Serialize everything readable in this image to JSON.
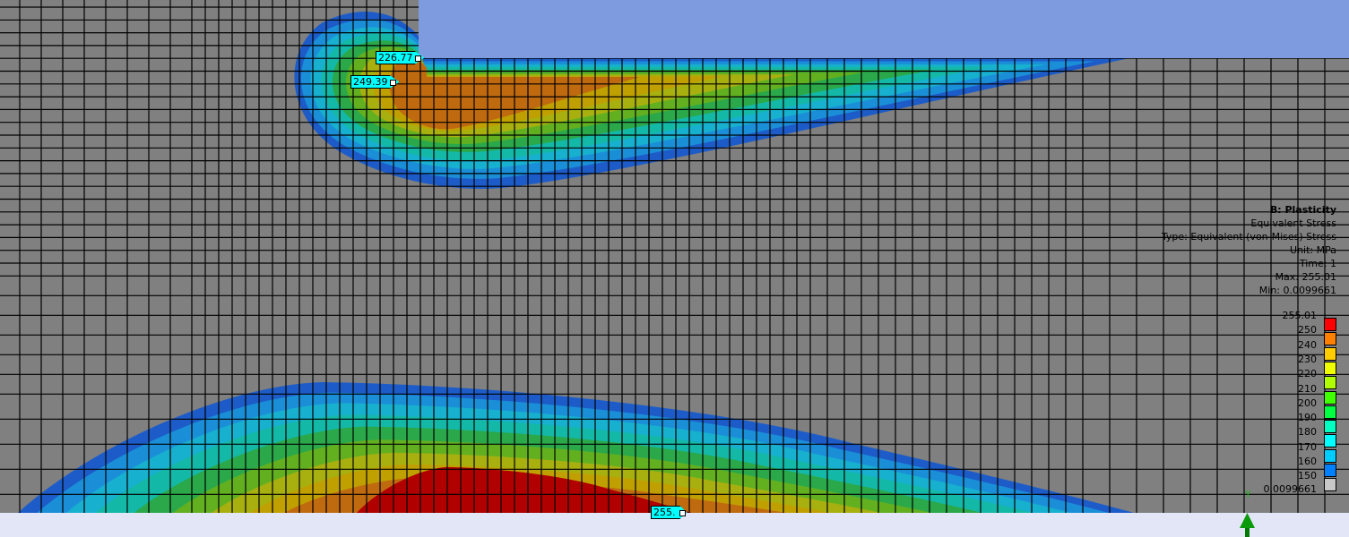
{
  "legend": {
    "title": "B: Plasticity",
    "result": "Equivalent Stress",
    "type": "Type: Equivalent (von-Mises) Stress",
    "unit": "Unit: MPa",
    "time": "Time: 1",
    "max": "Max: 255.01",
    "min": "Min: 0.0099661",
    "scale": [
      {
        "label": "255.01",
        "color": "#ff0000"
      },
      {
        "label": "250",
        "color": "#ff8000"
      },
      {
        "label": "240",
        "color": "#ffcc00"
      },
      {
        "label": "230",
        "color": "#f0ff00"
      },
      {
        "label": "220",
        "color": "#b0ff00"
      },
      {
        "label": "210",
        "color": "#40ff00"
      },
      {
        "label": "200",
        "color": "#00ff40"
      },
      {
        "label": "190",
        "color": "#00ffc0"
      },
      {
        "label": "180",
        "color": "#00ffff"
      },
      {
        "label": "170",
        "color": "#00ccff"
      },
      {
        "label": "160",
        "color": "#0080ff"
      },
      {
        "label": "150",
        "color": "#c8c8c8"
      }
    ],
    "min_label": "0.0099661"
  },
  "probes": [
    {
      "value": "226.77"
    },
    {
      "value": "249.39"
    },
    {
      "value": "255."
    }
  ],
  "triad": {
    "y_label": "Y"
  },
  "colors": {
    "mesh_bg": "#808080",
    "body_block": "#7f9be0",
    "ground": "#e2e6f6"
  }
}
